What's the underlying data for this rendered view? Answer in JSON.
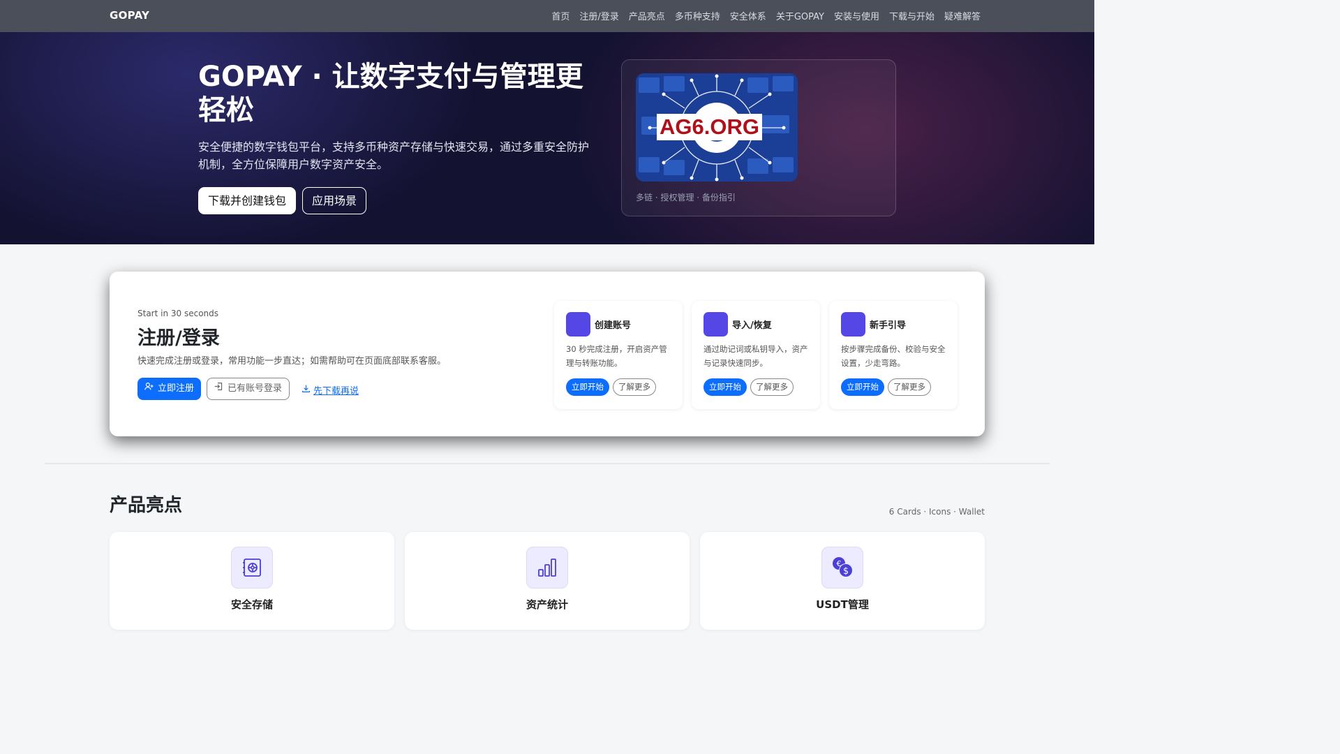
{
  "nav": {
    "brand": "GOPAY",
    "links": [
      "首页",
      "注册/登录",
      "产品亮点",
      "多币种支持",
      "安全体系",
      "关于GOPAY",
      "安装与使用",
      "下载与开始",
      "疑难解答"
    ]
  },
  "hero": {
    "title": "GOPAY · 让数字支付与管理更轻松",
    "description": "安全便捷的数字钱包平台，支持多币种资产存储与快速交易，通过多重安全防护机制，全方位保障用户数字资产安全。",
    "primary_button": "下载并创建钱包",
    "secondary_button": "应用场景",
    "image_label": "AG6.ORG",
    "caption": "多链 · 授权管理 · 备份指引"
  },
  "register": {
    "eyebrow": "Start in 30 seconds",
    "title": "注册/登录",
    "description": "快速完成注册或登录，常用功能一步直达；如需帮助可在页面底部联系客服。",
    "register_button": "立即注册",
    "login_button": "已有账号登录",
    "download_link": "先下载再说",
    "steps": [
      {
        "title": "创建账号",
        "desc": "30 秒完成注册，开启资产管理与转账功能。",
        "go": "立即开始",
        "more": "了解更多"
      },
      {
        "title": "导入/恢复",
        "desc": "通过助记词或私钥导入，资产与记录快速同步。",
        "go": "立即开始",
        "more": "了解更多"
      },
      {
        "title": "新手引导",
        "desc": "按步骤完成备份、校验与安全设置，少走弯路。",
        "go": "立即开始",
        "more": "了解更多"
      }
    ]
  },
  "features": {
    "title": "产品亮点",
    "meta": "6 Cards · Icons · Wallet",
    "cards": [
      {
        "name": "安全存储",
        "icon": "safe-icon"
      },
      {
        "name": "资产统计",
        "icon": "bar-chart-icon"
      },
      {
        "name": "USDT管理",
        "icon": "currency-exchange-icon"
      }
    ]
  },
  "colors": {
    "primary": "#0d6efd",
    "accent": "#5546e6",
    "navbar": "#4a4f5a",
    "hero_bg": "#141231"
  }
}
